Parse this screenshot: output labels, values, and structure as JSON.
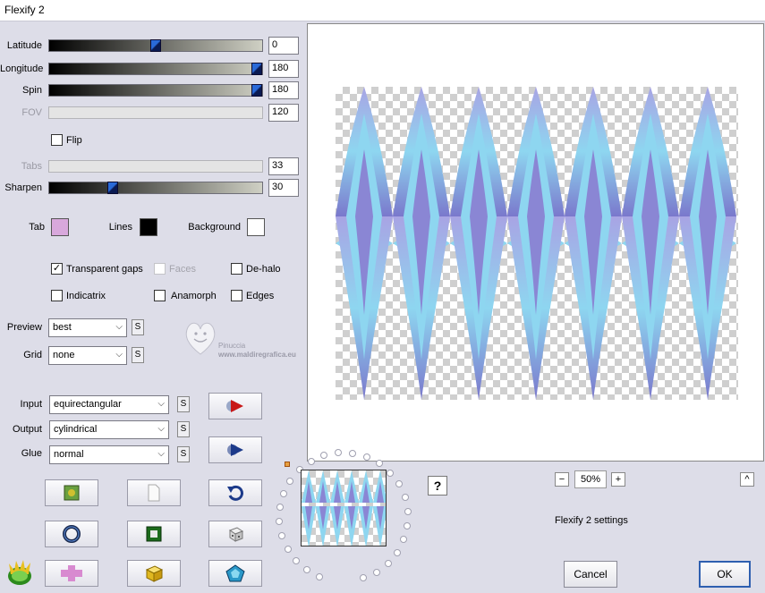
{
  "window": {
    "title": "Flexify 2"
  },
  "params": {
    "latitude": {
      "label": "Latitude",
      "value": "0",
      "fraction": 0.5
    },
    "longitude": {
      "label": "Longitude",
      "value": "180",
      "fraction": 1.0
    },
    "spin": {
      "label": "Spin",
      "value": "180",
      "fraction": 1.0
    },
    "fov": {
      "label": "FOV",
      "value": "120"
    },
    "tabs": {
      "label": "Tabs",
      "value": "33"
    },
    "sharpen": {
      "label": "Sharpen",
      "value": "30",
      "fraction": 0.3
    }
  },
  "flip": {
    "label": "Flip",
    "checked": false
  },
  "colors": {
    "tab": {
      "label": "Tab",
      "color": "#d8a8dc"
    },
    "lines": {
      "label": "Lines",
      "color": "#000000"
    },
    "background": {
      "label": "Background",
      "color": "#ffffff"
    }
  },
  "options": {
    "transparent_gaps": {
      "label": "Transparent gaps",
      "checked": true,
      "mark": "✓"
    },
    "faces": {
      "label": "Faces",
      "checked": false
    },
    "de_halo": {
      "label": "De-halo",
      "checked": false
    },
    "indicatrix": {
      "label": "Indicatrix",
      "checked": false
    },
    "anamorph": {
      "label": "Anamorph",
      "checked": false
    },
    "edges": {
      "label": "Edges",
      "checked": false
    }
  },
  "preview_mode": {
    "label": "Preview",
    "value": "best"
  },
  "grid": {
    "label": "Grid",
    "value": "none"
  },
  "input": {
    "label": "Input",
    "value": "equirectangular"
  },
  "output": {
    "label": "Output",
    "value": "cylindrical"
  },
  "glue": {
    "label": "Glue",
    "value": "normal"
  },
  "s_label": "S",
  "watermark": {
    "line1": "Pinuccia",
    "line2": "www.maldiregrafica.eu"
  },
  "zoom": {
    "value": "50%",
    "minus": "−",
    "plus": "+"
  },
  "help_label": "?",
  "collapse_label": "^",
  "status": "Flexify 2 settings",
  "buttons": {
    "cancel": "Cancel",
    "ok": "OK"
  },
  "accent": {
    "pattern_light": "#8ed6f0",
    "pattern_dark": "#8a86d4",
    "pattern_mid": "#6fb8e8"
  }
}
